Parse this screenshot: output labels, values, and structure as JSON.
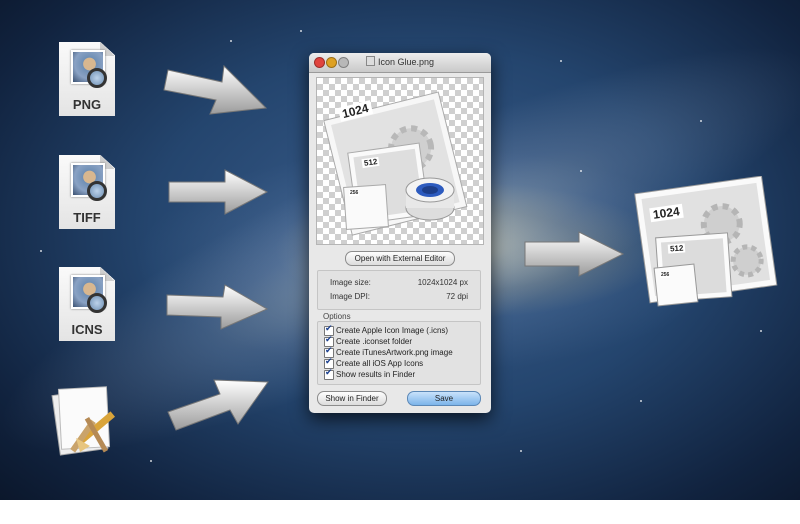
{
  "formats": [
    {
      "label": "PNG"
    },
    {
      "label": "TIFF"
    },
    {
      "label": "ICNS"
    }
  ],
  "window": {
    "title": "Icon Glue.png",
    "open_button": "Open with External Editor",
    "info": {
      "size_label": "Image size:",
      "size_value": "1024x1024 px",
      "dpi_label": "Image DPI:",
      "dpi_value": "72 dpi"
    },
    "options_title": "Options",
    "options": [
      {
        "label": "Create Apple Icon Image (.icns)",
        "checked": true
      },
      {
        "label": "Create .iconset folder",
        "checked": true
      },
      {
        "label": "Create iTunesArtwork.png image",
        "checked": true
      },
      {
        "label": "Create all iOS App Icons",
        "checked": true
      },
      {
        "label": "Show results in Finder",
        "checked": true
      }
    ],
    "show_in_finder": "Show in Finder",
    "save": "Save"
  },
  "preview": {
    "size_badge_large": "1024",
    "size_badge_medium": "512",
    "size_badge_small": "256"
  },
  "result": {
    "size_badge_large": "1024",
    "size_badge_medium": "512",
    "size_badge_small": "256"
  },
  "colors": {
    "accent_button": "#7cb4ea",
    "close": "#e0443e",
    "minimize": "#dea123",
    "zoom": "#b8b8b8"
  }
}
